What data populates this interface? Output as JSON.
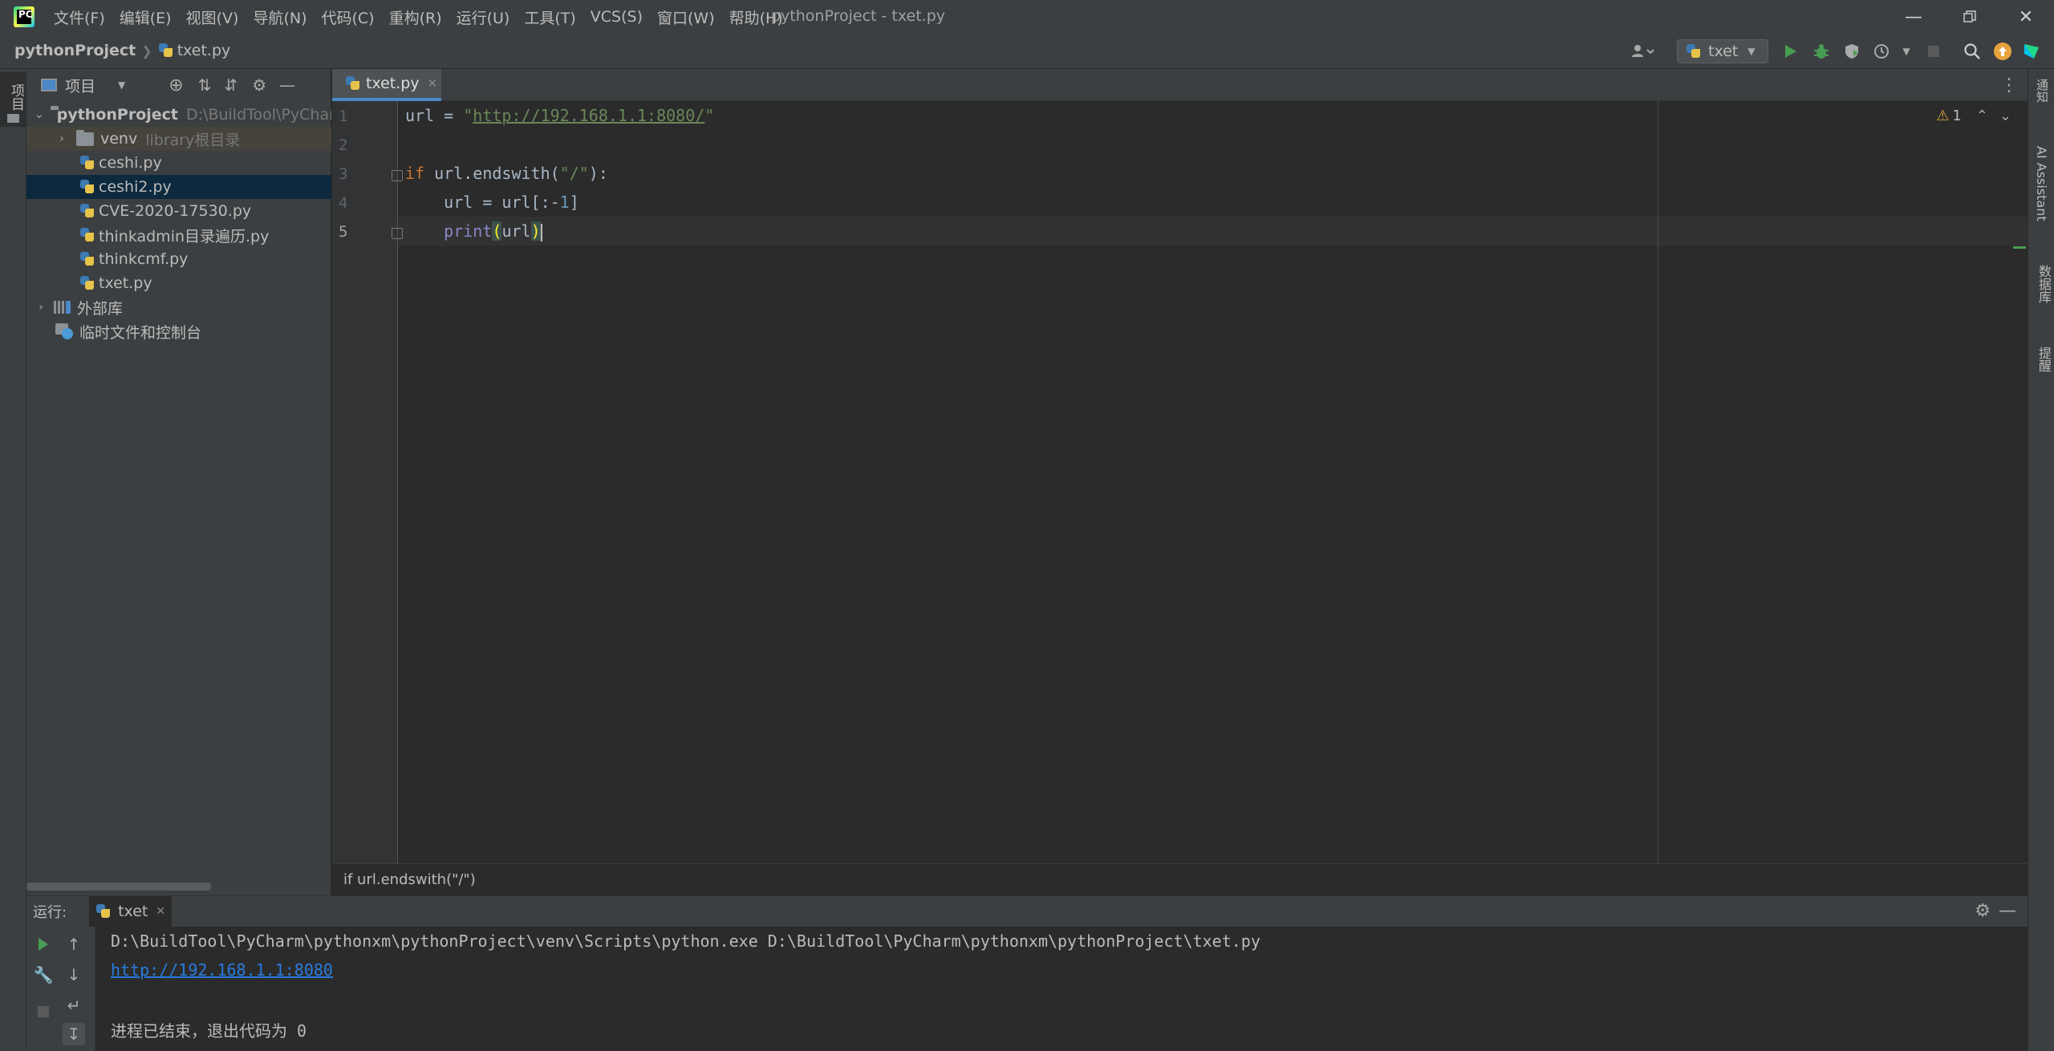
{
  "window": {
    "title": "pythonProject - txet.py",
    "menu": [
      "文件(F)",
      "编辑(E)",
      "视图(V)",
      "导航(N)",
      "代码(C)",
      "重构(R)",
      "运行(U)",
      "工具(T)",
      "VCS(S)",
      "窗口(W)",
      "帮助(H)"
    ],
    "logo_text": "PC"
  },
  "navbar": {
    "project": "pythonProject",
    "file": "txet.py",
    "run_config": "txet"
  },
  "left_stripe": {
    "project_tab": "项目"
  },
  "right_stripe": {
    "tabs": [
      "通知",
      "AI Assistant",
      "数据库",
      "提醒"
    ]
  },
  "project_panel": {
    "title": "项目",
    "root": {
      "name": "pythonProject",
      "path": "D:\\BuildTool\\PyCharm"
    },
    "venv": {
      "name": "venv",
      "hint": "library根目录"
    },
    "files": [
      "ceshi.py",
      "ceshi2.py",
      "CVE-2020-17530.py",
      "thinkadmin目录遍历.py",
      "thinkcmf.py",
      "txet.py"
    ],
    "external_libs": "外部库",
    "scratches": "临时文件和控制台"
  },
  "editor": {
    "tab": "txet.py",
    "line_numbers": [
      "1",
      "2",
      "3",
      "4",
      "5"
    ],
    "warning_count": "1",
    "code": {
      "l1_a": "url = ",
      "l1_q1": "\"",
      "l1_url": "http://192.168.1.1:8080/",
      "l1_q2": "\"",
      "l3_kw": "if",
      "l3_rest": " url.endswith(",
      "l3_str": "\"/\"",
      "l3_end": "):",
      "l4_a": "    url = url[:-",
      "l4_num": "1",
      "l4_end": "]",
      "l5_indent": "    ",
      "l5_builtin": "print",
      "l5_open": "(",
      "l5_arg": "url",
      "l5_close": ")"
    },
    "breadcrumb": "if url.endswith(\"/\")"
  },
  "run_panel": {
    "label": "运行:",
    "tab": "txet",
    "output": {
      "cmd": "D:\\BuildTool\\PyCharm\\pythonxm\\pythonProject\\venv\\Scripts\\python.exe D:\\BuildTool\\PyCharm\\pythonxm\\pythonProject\\txet.py",
      "result": "http://192.168.1.1:8080",
      "exit": "进程已结束，退出代码为 0"
    }
  },
  "colors": {
    "accent": "#4a88c7",
    "run_green": "#499c54",
    "selection": "#0d293e",
    "link": "#287bde"
  }
}
